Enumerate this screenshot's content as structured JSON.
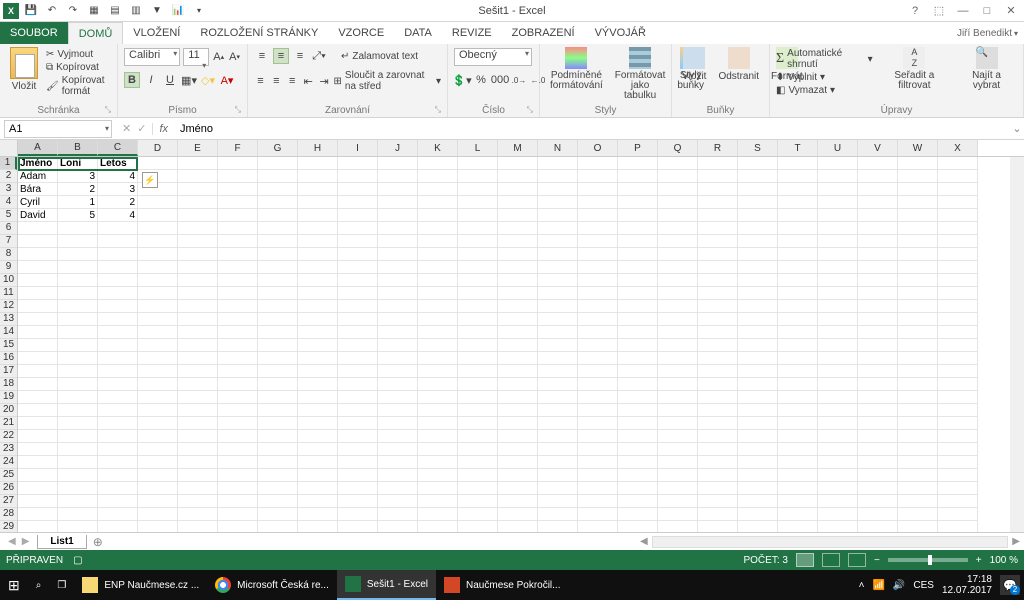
{
  "app": {
    "title": "Sešit1 - Excel",
    "user": "Jiří Benedikt"
  },
  "tabs": {
    "file": "SOUBOR",
    "home": "DOMŮ",
    "insert": "VLOŽENÍ",
    "layout": "ROZLOŽENÍ STRÁNKY",
    "formulas": "VZORCE",
    "data": "DATA",
    "review": "REVIZE",
    "view": "ZOBRAZENÍ",
    "dev": "VÝVOJÁŘ"
  },
  "ribbon": {
    "clipboard": {
      "label": "Schránka",
      "paste": "Vložit",
      "cut": "Vyjmout",
      "copy": "Kopírovat",
      "fmtpainter": "Kopírovat formát"
    },
    "font": {
      "label": "Písmo",
      "name": "Calibri",
      "size": "11"
    },
    "align": {
      "label": "Zarovnání",
      "wrap": "Zalamovat text",
      "merge": "Sloučit a zarovnat na střed"
    },
    "number": {
      "label": "Číslo",
      "format": "Obecný"
    },
    "styles": {
      "label": "Styly",
      "cond": "Podmíněné formátování",
      "table": "Formátovat jako tabulku",
      "cell": "Styly buňky"
    },
    "cells": {
      "label": "Buňky",
      "insert": "Vložit",
      "delete": "Odstranit",
      "format": "Formát"
    },
    "editing": {
      "label": "Úpravy",
      "sum": "Automatické shrnutí",
      "fill": "Vyplnit",
      "clear": "Vymazat",
      "sort": "Seřadit a filtrovat",
      "find": "Najít a vybrat"
    }
  },
  "fbar": {
    "ref": "A1",
    "value": "Jméno"
  },
  "cols": [
    "A",
    "B",
    "C",
    "D",
    "E",
    "F",
    "G",
    "H",
    "I",
    "J",
    "K",
    "L",
    "M",
    "N",
    "O",
    "P",
    "Q",
    "R",
    "S",
    "T",
    "U",
    "V",
    "W",
    "X"
  ],
  "data": {
    "r1": {
      "a": "Jméno",
      "b": "Loni",
      "c": "Letos"
    },
    "r2": {
      "a": "Adam",
      "b": "3",
      "c": "4"
    },
    "r3": {
      "a": "Bára",
      "b": "2",
      "c": "3"
    },
    "r4": {
      "a": "Cyril",
      "b": "1",
      "c": "2"
    },
    "r5": {
      "a": "David",
      "b": "5",
      "c": "4"
    }
  },
  "sheet": {
    "name": "List1"
  },
  "status": {
    "ready": "PŘIPRAVEN",
    "count_lbl": "POČET: 3",
    "zoom": "100 %"
  },
  "taskbar": {
    "t1": "ENP Naučmese.cz ...",
    "t2": "Microsoft Česká re...",
    "t3": "Sešit1 - Excel",
    "t4": "Naučmese Pokročil...",
    "lang": "CES",
    "time": "17:18",
    "date": "12.07.2017"
  }
}
